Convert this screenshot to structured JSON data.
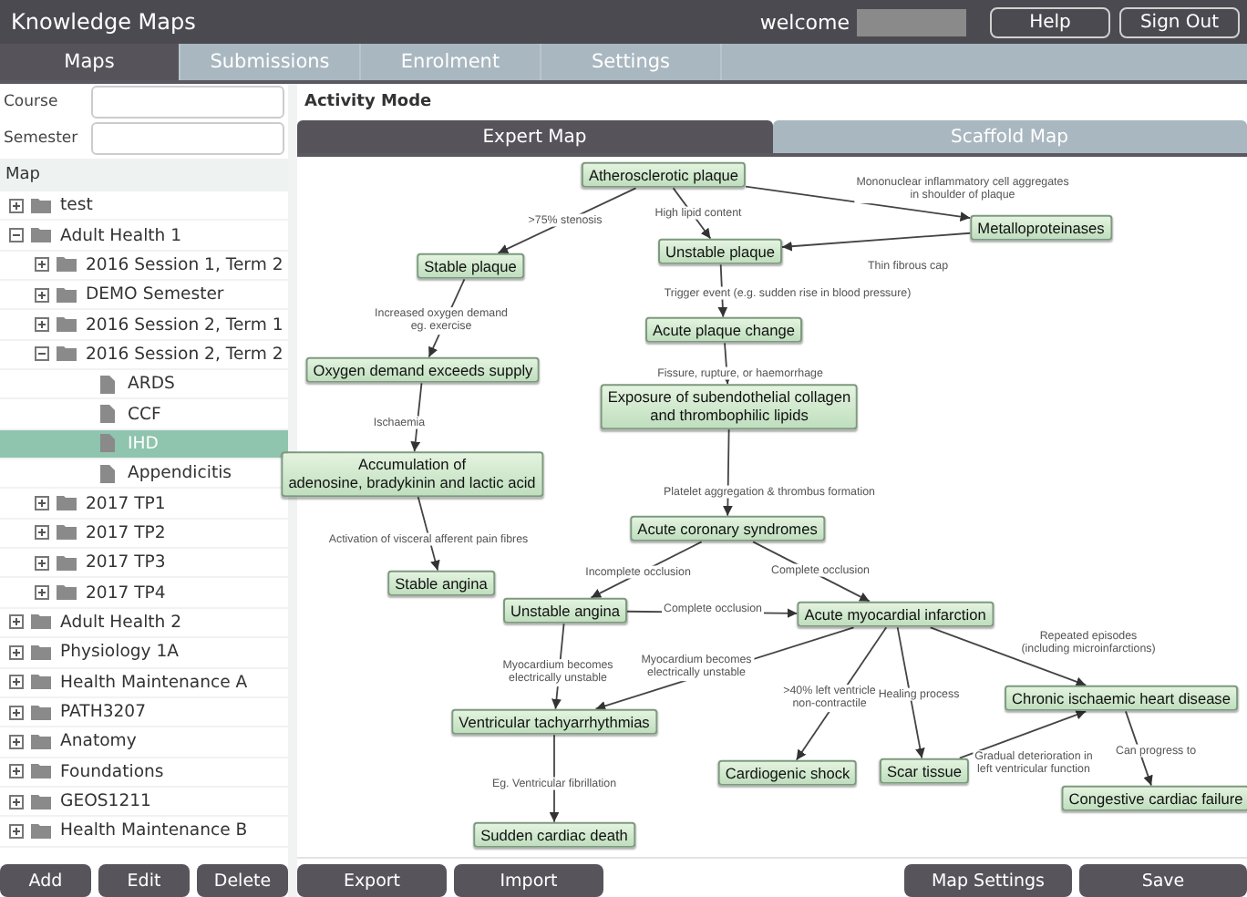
{
  "header": {
    "title": "Knowledge Maps",
    "welcome": "welcome",
    "buttons": [
      "Help",
      "Sign Out"
    ]
  },
  "tabs": [
    {
      "label": "Maps",
      "selected": true
    },
    {
      "label": "Submissions",
      "selected": false
    },
    {
      "label": "Enrolment",
      "selected": false
    },
    {
      "label": "Settings",
      "selected": false
    }
  ],
  "sidebar": {
    "fields": [
      {
        "label": "Course"
      },
      {
        "label": "Semester"
      }
    ],
    "tree_title": "Map",
    "tree": [
      {
        "label": "test",
        "kind": "folder",
        "expanded": false,
        "selected": false
      },
      {
        "label": "Adult Health 1",
        "kind": "folder",
        "expanded": true,
        "selected": false,
        "children": [
          {
            "label": "2016 Session 1, Term 2",
            "kind": "folder",
            "expanded": false,
            "selected": false
          },
          {
            "label": "DEMO Semester",
            "kind": "folder",
            "expanded": false,
            "selected": false
          },
          {
            "label": "2016 Session 2, Term 1",
            "kind": "folder",
            "expanded": false,
            "selected": false
          },
          {
            "label": "2016 Session 2, Term 2",
            "kind": "folder",
            "expanded": true,
            "selected": false,
            "children": [
              {
                "label": "ARDS",
                "kind": "map",
                "selected": false
              },
              {
                "label": "CCF",
                "kind": "map",
                "selected": false
              },
              {
                "label": "IHD",
                "kind": "map",
                "selected": true
              },
              {
                "label": "Appendicitis",
                "kind": "map",
                "selected": false
              }
            ]
          },
          {
            "label": "2017 TP1",
            "kind": "folder",
            "expanded": false,
            "selected": false
          },
          {
            "label": "2017 TP2",
            "kind": "folder",
            "expanded": false,
            "selected": false
          },
          {
            "label": "2017 TP3",
            "kind": "folder",
            "expanded": false,
            "selected": false
          },
          {
            "label": "2017 TP4",
            "kind": "folder",
            "expanded": false,
            "selected": false
          }
        ]
      },
      {
        "label": "Adult Health 2",
        "kind": "folder",
        "expanded": false,
        "selected": false
      },
      {
        "label": "Physiology 1A",
        "kind": "folder",
        "expanded": false,
        "selected": false
      },
      {
        "label": "Health Maintenance A",
        "kind": "folder",
        "expanded": false,
        "selected": false
      },
      {
        "label": "PATH3207",
        "kind": "folder",
        "expanded": false,
        "selected": false
      },
      {
        "label": "Anatomy",
        "kind": "folder",
        "expanded": false,
        "selected": false
      },
      {
        "label": "Foundations",
        "kind": "folder",
        "expanded": false,
        "selected": false
      },
      {
        "label": "GEOS1211",
        "kind": "folder",
        "expanded": false,
        "selected": false
      },
      {
        "label": "Health Maintenance B",
        "kind": "folder",
        "expanded": false,
        "selected": false
      }
    ],
    "buttons": [
      "Add",
      "Edit",
      "Delete"
    ]
  },
  "main": {
    "title": "Activity Mode",
    "map_tabs": [
      {
        "label": "Expert Map",
        "selected": true
      },
      {
        "label": "Scaffold Map",
        "selected": false
      }
    ],
    "concepts": [
      "Atherosclerotic plaque",
      "Metalloproteinases",
      "Stable plaque",
      "Unstable plaque",
      "Acute plaque change",
      "Oxygen demand exceeds supply",
      "Exposure of subendothelial collagen\nand thrombophilic lipids",
      "Accumulation of\nadenosine, bradykinin and lactic acid",
      "Acute coronary syndromes",
      "Stable angina",
      "Unstable angina",
      "Acute myocardial infarction",
      "Chronic ischaemic heart disease",
      "Ventricular tachyarrhythmias",
      "Cardiogenic shock",
      "Scar tissue",
      "Congestive cardiac failure",
      "Sudden cardiac death"
    ],
    "links": [
      ">75% stenosis",
      "High lipid content",
      "Mononuclear inflammatory cell aggregates\nin shoulder of plaque",
      "Thin fibrous cap",
      "Trigger event (e.g. sudden rise in blood pressure)",
      "Increased oxygen demand\neg. exercise",
      "Fissure, rupture, or haemorrhage",
      "Ischaemia",
      "Platelet aggregation & thrombus formation",
      "Activation of visceral afferent pain fibres",
      "Incomplete occlusion",
      "Complete occlusion",
      "Complete occlusion",
      "Myocardium becomes\nelectrically unstable",
      "Myocardium becomes\nelectrically unstable",
      ">40% left ventricle\nnon-contractile",
      "Healing process",
      "Repeated episodes\n(including microinfarctions)",
      "Gradual deterioration in\nleft ventricular function",
      "Can progress to",
      "Eg. Ventricular fibrillation"
    ],
    "left_buttons": [
      "Export",
      "Import"
    ],
    "right_buttons": [
      "Map Settings",
      "Save"
    ]
  }
}
